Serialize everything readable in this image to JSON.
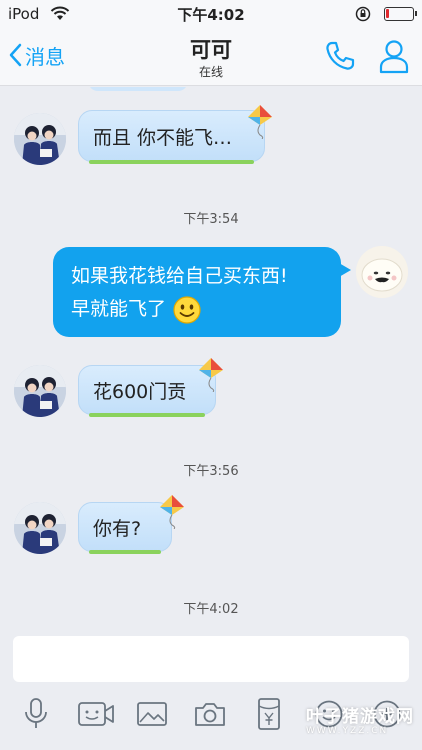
{
  "status": {
    "carrier": "iPod",
    "time": "下午4:02",
    "battery_level": 0.12,
    "battery_color": "#e0292e"
  },
  "nav": {
    "back_label": "消息",
    "title": "可可",
    "subtitle": "在线",
    "accent": "#14a3f5"
  },
  "messages": [
    {
      "side": "left",
      "text": "而且 你不能飞…"
    },
    {
      "type": "timestamp",
      "text": "下午3:54"
    },
    {
      "side": "right",
      "lines": [
        "如果我花钱给自己买东西!",
        "早就能飞了"
      ],
      "emoji": "smiley"
    },
    {
      "side": "left",
      "text": "花600门贡"
    },
    {
      "type": "timestamp",
      "text": "下午3:56"
    },
    {
      "side": "left",
      "text": "你有?"
    },
    {
      "type": "timestamp",
      "text": "下午4:02"
    }
  ],
  "input": {
    "value": "",
    "placeholder": ""
  },
  "toolbar": [
    "microphone-icon",
    "video-icon",
    "image-icon",
    "camera-icon",
    "red-packet-icon",
    "emoji-icon",
    "plus-icon"
  ],
  "watermark": {
    "brand": "叶子猪游戏网",
    "url": "WWW.YZZ.CN"
  }
}
